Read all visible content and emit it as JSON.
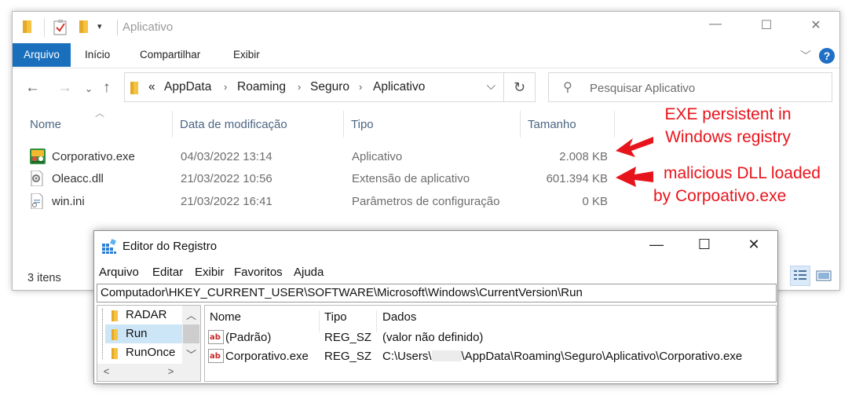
{
  "explorer": {
    "title": "Aplicativo",
    "ribbon_tabs": [
      "Arquivo",
      "Início",
      "Compartilhar",
      "Exibir"
    ],
    "breadcrumb": {
      "prefix": "«",
      "items": [
        "AppData",
        "Roaming",
        "Seguro",
        "Aplicativo"
      ]
    },
    "search_placeholder": "Pesquisar Aplicativo",
    "columns": {
      "name": "Nome",
      "modified": "Data de modificação",
      "type": "Tipo",
      "size": "Tamanho"
    },
    "files": [
      {
        "name": "Corporativo.exe",
        "modified": "04/03/2022 13:14",
        "type": "Aplicativo",
        "size": "2.008 KB",
        "icon": "exe-app-icon"
      },
      {
        "name": "Oleacc.dll",
        "modified": "21/03/2022 10:56",
        "type": "Extensão de aplicativo",
        "size": "601.394 KB",
        "icon": "dll-file-icon"
      },
      {
        "name": "win.ini",
        "modified": "21/03/2022 16:41",
        "type": "Parâmetros de configuração",
        "size": "0 KB",
        "icon": "ini-file-icon"
      }
    ],
    "status": "3 itens",
    "accent": "#1a6fbd"
  },
  "annotations": {
    "exe_line1": "EXE persistent in",
    "exe_line2": "Windows registry",
    "dll_line1": "malicious DLL loaded",
    "dll_line2": "by Corpoativo.exe",
    "color": "#e8141c"
  },
  "regedit": {
    "title": "Editor do Registro",
    "menu": [
      "Arquivo",
      "Editar",
      "Exibir",
      "Favoritos",
      "Ajuda"
    ],
    "path": "Computador\\HKEY_CURRENT_USER\\SOFTWARE\\Microsoft\\Windows\\CurrentVersion\\Run",
    "tree": [
      "RADAR",
      "Run",
      "RunOnce"
    ],
    "columns": {
      "name": "Nome",
      "type": "Tipo",
      "data": "Dados"
    },
    "values": [
      {
        "name": "(Padrão)",
        "type": "REG_SZ",
        "data": "(valor não definido)"
      },
      {
        "name": "Corporativo.exe",
        "type": "REG_SZ",
        "data_prefix": "C:\\Users\\",
        "data_suffix": "\\AppData\\Roaming\\Seguro\\Aplicativo\\Corporativo.exe"
      }
    ]
  }
}
